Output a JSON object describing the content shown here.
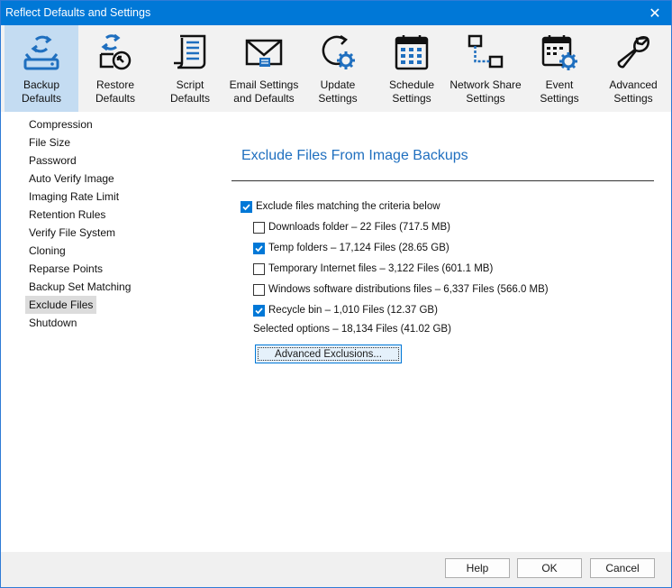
{
  "window": {
    "title": "Reflect Defaults and Settings",
    "close_glyph": "✕"
  },
  "toolbar": {
    "items": [
      {
        "label": "Backup\nDefaults",
        "icon": "backup-drive-icon",
        "active": true
      },
      {
        "label": "Restore\nDefaults",
        "icon": "restore-icon",
        "active": false
      },
      {
        "label": "Script\nDefaults",
        "icon": "script-icon",
        "active": false
      },
      {
        "label": "Email Settings\nand Defaults",
        "icon": "envelope-icon",
        "active": false
      },
      {
        "label": "Update\nSettings",
        "icon": "update-gear-icon",
        "active": false
      },
      {
        "label": "Schedule\nSettings",
        "icon": "calendar-icon",
        "active": false
      },
      {
        "label": "Network Share\nSettings",
        "icon": "network-icon",
        "active": false
      },
      {
        "label": "Event\nSettings",
        "icon": "event-calendar-gear-icon",
        "active": false
      },
      {
        "label": "Advanced\nSettings",
        "icon": "wrench-icon",
        "active": false
      }
    ]
  },
  "sidebar": {
    "items": [
      "Compression",
      "File Size",
      "Password",
      "Auto Verify Image",
      "Imaging Rate Limit",
      "Retention Rules",
      "Verify File System",
      "Cloning",
      "Reparse Points",
      "Backup Set Matching",
      "Exclude Files",
      "Shutdown"
    ],
    "selected": "Exclude Files"
  },
  "main": {
    "heading": "Exclude Files From Image Backups",
    "master_option": {
      "label": "Exclude files matching the criteria below",
      "checked": true
    },
    "options": [
      {
        "label": "Downloads folder – 22 Files (717.5 MB)",
        "checked": false
      },
      {
        "label": "Temp folders – 17,124 Files (28.65 GB)",
        "checked": true
      },
      {
        "label": "Temporary Internet files – 3,122 Files (601.1 MB)",
        "checked": false
      },
      {
        "label": "Windows software distributions files – 6,337 Files (566.0 MB)",
        "checked": false
      },
      {
        "label": "Recycle bin – 1,010 Files (12.37 GB)",
        "checked": true
      }
    ],
    "summary": "Selected options – 18,134 Files (41.02 GB)",
    "advanced_button": "Advanced Exclusions..."
  },
  "footer": {
    "help": "Help",
    "ok": "OK",
    "cancel": "Cancel"
  },
  "colors": {
    "accent": "#0078d7",
    "heading": "#1f6fbf",
    "active_tool": "#c4dcf2"
  }
}
